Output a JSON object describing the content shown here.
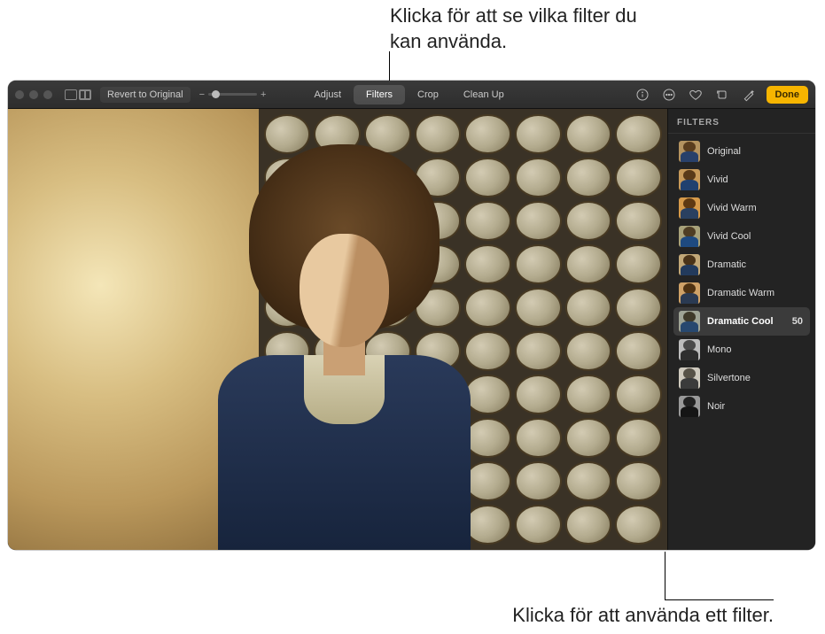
{
  "callouts": {
    "top": "Klicka för att se vilka filter du kan använda.",
    "bottom": "Klicka för att använda ett filter."
  },
  "toolbar": {
    "revert_label": "Revert to Original",
    "tabs": [
      {
        "label": "Adjust",
        "active": false
      },
      {
        "label": "Filters",
        "active": true
      },
      {
        "label": "Crop",
        "active": false
      },
      {
        "label": "Clean Up",
        "active": false
      }
    ],
    "done_label": "Done"
  },
  "panel": {
    "title": "FILTERS",
    "selected_value": "50",
    "filters": [
      {
        "label": "Original",
        "thumb": {
          "bg": "#b49360",
          "hair": "#5a3d1e",
          "body": "#28406a"
        },
        "selected": false
      },
      {
        "label": "Vivid",
        "thumb": {
          "bg": "#c89a5a",
          "hair": "#5a3a18",
          "body": "#20406f"
        },
        "selected": false
      },
      {
        "label": "Vivid Warm",
        "thumb": {
          "bg": "#d69a4a",
          "hair": "#5f3912",
          "body": "#2a4060"
        },
        "selected": false
      },
      {
        "label": "Vivid Cool",
        "thumb": {
          "bg": "#a8a27a",
          "hair": "#4f3e24",
          "body": "#1e4a80"
        },
        "selected": false
      },
      {
        "label": "Dramatic",
        "thumb": {
          "bg": "#c2a878",
          "hair": "#4a3318",
          "body": "#223a5c"
        },
        "selected": false
      },
      {
        "label": "Dramatic Warm",
        "thumb": {
          "bg": "#cfa268",
          "hair": "#4e3212",
          "body": "#2a3a52"
        },
        "selected": false
      },
      {
        "label": "Dramatic Cool",
        "thumb": {
          "bg": "#9fa496",
          "hair": "#3f3a2a",
          "body": "#27486f"
        },
        "selected": true
      },
      {
        "label": "Mono",
        "thumb": {
          "bg": "#bdbdbd",
          "hair": "#4a4a4a",
          "body": "#2e2e2e"
        },
        "selected": false
      },
      {
        "label": "Silvertone",
        "thumb": {
          "bg": "#cfcabe",
          "hair": "#575247",
          "body": "#3b3b3b"
        },
        "selected": false
      },
      {
        "label": "Noir",
        "thumb": {
          "bg": "#9a9a9a",
          "hair": "#222222",
          "body": "#151515"
        },
        "selected": false
      }
    ]
  }
}
